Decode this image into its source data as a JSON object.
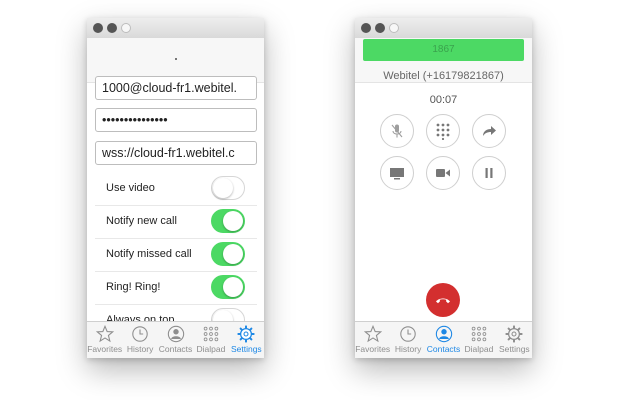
{
  "settings": {
    "sip_account_value": "1000@cloud-fr1.webitel.",
    "password_value": "•••••••••••••••",
    "server_url_value": "wss://cloud-fr1.webitel.c",
    "options": [
      {
        "label": "Use video",
        "enabled": false
      },
      {
        "label": "Notify new call",
        "enabled": true
      },
      {
        "label": "Notify missed call",
        "enabled": true
      },
      {
        "label": "Ring! Ring!",
        "enabled": true
      },
      {
        "label": "Always on top",
        "enabled": false
      }
    ]
  },
  "call": {
    "number": "1867",
    "caller": "Webitel (+16179821867)",
    "duration": "00:07"
  },
  "tabs": {
    "favorites": "Favorites",
    "history": "History",
    "contacts": "Contacts",
    "dialpad": "Dialpad",
    "settings": "Settings"
  },
  "left_active_tab": "settings",
  "right_active_tab": "contacts",
  "colors": {
    "toggle_on": "#4cd964",
    "active_tab": "#1e88e5",
    "hangup": "#d32f2f",
    "number_bar": "#4cd964"
  },
  "icons": [
    "star-icon",
    "clock-icon",
    "person-icon",
    "dialpad-icon",
    "gear-icon",
    "mic-muted-icon",
    "keypad-icon",
    "forward-arrow-icon",
    "screen-icon",
    "video-camera-icon",
    "pause-icon",
    "hang-up-icon"
  ]
}
